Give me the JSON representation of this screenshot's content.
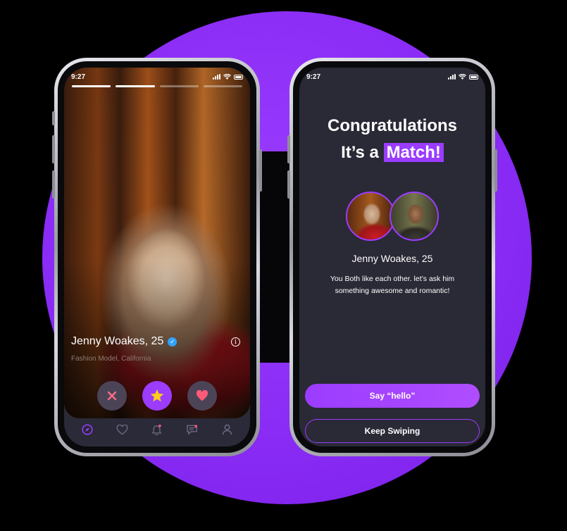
{
  "left_phone": {
    "status_time": "9:27",
    "story_progress": [
      true,
      true,
      false,
      false
    ],
    "profile": {
      "name": "Jenny Woakes, 25",
      "subtitle": "Fashion Model, California"
    },
    "actions": [
      "dislike",
      "super-like",
      "like"
    ],
    "tabs": [
      "discover-icon",
      "heart-icon",
      "bell-icon",
      "chat-icon",
      "profile-icon"
    ]
  },
  "right_phone": {
    "status_time": "9:27",
    "title_line1": "Congratulations",
    "title_line2_prefix": "It’s a",
    "title_line2_highlight": "Match!",
    "match_name": "Jenny Woakes, 25",
    "message": "You Both like each other. let’s ask him something awesome and romantic!",
    "primary_button": "Say “hello”",
    "secondary_button": "Keep Swiping"
  },
  "colors": {
    "accent": "#9b3cff",
    "screen_bg": "#2a2936",
    "action_bg": "#4b4457",
    "dislike": "#ff6b8a",
    "star": "#ffcc1a",
    "like": "#ff5a7a",
    "verified": "#2fa4ff"
  }
}
